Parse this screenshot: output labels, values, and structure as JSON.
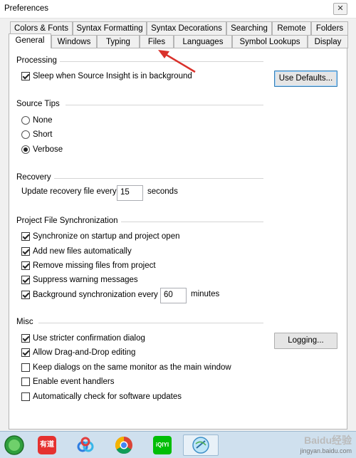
{
  "window": {
    "title": "Preferences",
    "close_glyph": "✕"
  },
  "tabs_row1": [
    {
      "label": "Colors & Fonts"
    },
    {
      "label": "Syntax Formatting"
    },
    {
      "label": "Syntax Decorations"
    },
    {
      "label": "Searching"
    },
    {
      "label": "Remote"
    },
    {
      "label": "Folders"
    }
  ],
  "tabs_row2": [
    {
      "label": "General",
      "selected": true
    },
    {
      "label": "Windows"
    },
    {
      "label": "Typing"
    },
    {
      "label": "Files"
    },
    {
      "label": "Languages"
    },
    {
      "label": "Symbol Lookups"
    },
    {
      "label": "Display"
    }
  ],
  "processing": {
    "title": "Processing",
    "sleep_label": "Sleep when Source Insight is in background",
    "sleep_checked": true,
    "use_defaults_label": "Use Defaults..."
  },
  "source_tips": {
    "title": "Source Tips",
    "options": [
      {
        "label": "None",
        "selected": false
      },
      {
        "label": "Short",
        "selected": false
      },
      {
        "label": "Verbose",
        "selected": true
      }
    ]
  },
  "recovery": {
    "title": "Recovery",
    "label": "Update recovery file every",
    "value": "15",
    "unit": "seconds"
  },
  "sync": {
    "title": "Project File Synchronization",
    "items": [
      {
        "label": "Synchronize on startup and project open",
        "checked": true
      },
      {
        "label": "Add new files automatically",
        "checked": true
      },
      {
        "label": "Remove missing files from project",
        "checked": true
      },
      {
        "label": "Suppress warning messages",
        "checked": true
      },
      {
        "label": "Background synchronization every",
        "checked": true
      }
    ],
    "bg_interval_value": "60",
    "bg_interval_unit": "minutes"
  },
  "misc": {
    "title": "Misc",
    "items": [
      {
        "label": "Use stricter confirmation dialog",
        "checked": true
      },
      {
        "label": "Allow Drag-and-Drop editing",
        "checked": true
      },
      {
        "label": "Keep dialogs on the same monitor as the main window",
        "checked": false
      },
      {
        "label": "Enable event handlers",
        "checked": false
      },
      {
        "label": "Automatically check for software updates",
        "checked": false
      }
    ],
    "logging_label": "Logging..."
  },
  "taskbar": {
    "items": [
      {
        "icon": "start-orb-icon"
      },
      {
        "icon": "youdao-icon",
        "text": "有道"
      },
      {
        "icon": "baidu-netdisk-icon"
      },
      {
        "icon": "chrome-icon"
      },
      {
        "icon": "iqiyi-icon",
        "text": "iQIYI"
      },
      {
        "icon": "source-insight-icon"
      }
    ],
    "watermark_big": "Baidu经验",
    "watermark_small": "jingyan.baidu.com"
  },
  "colors": {
    "accent": "#3c7fb1",
    "arrow": "#d9312b"
  }
}
